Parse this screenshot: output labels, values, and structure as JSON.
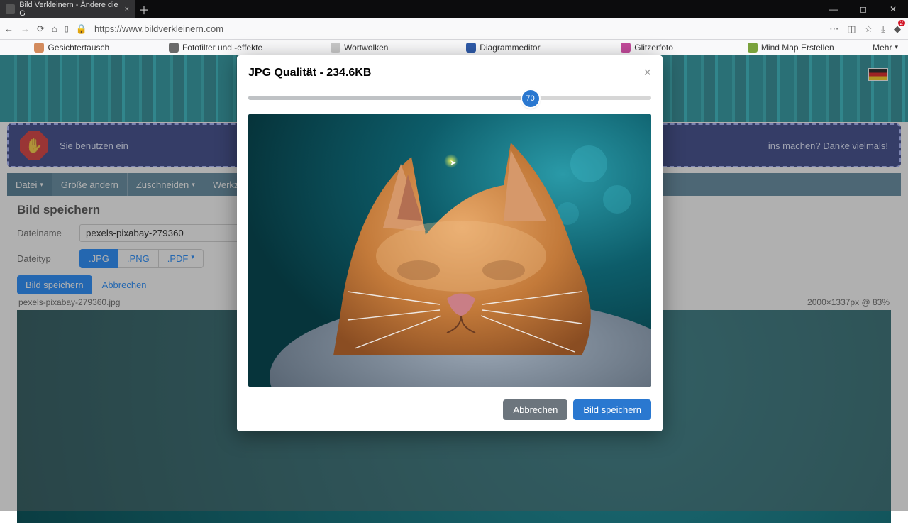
{
  "browser": {
    "tab_title": "Bild Verkleinern - Ändere die G",
    "url": "https://www.bildverkleinern.com",
    "bookmarks": [
      {
        "label": "Gesichtertausch",
        "color": "#d38b5d"
      },
      {
        "label": "Fotofilter und -effekte",
        "color": "#6a6a6a"
      },
      {
        "label": "Wortwolken",
        "color": "#c8c8c8"
      },
      {
        "label": "Diagrammeditor",
        "color": "#2e5aa8"
      },
      {
        "label": "Glitzerfoto",
        "color": "#c24a9a"
      },
      {
        "label": "Mind Map Erstellen",
        "color": "#7aa23c"
      }
    ],
    "more": "Mehr"
  },
  "toolbar": {
    "items": [
      "Datei",
      "Größe ändern",
      "Zuschneiden",
      "Werkzeuge"
    ]
  },
  "form": {
    "heading": "Bild speichern",
    "filename_label": "Dateiname",
    "filename_value": "pexels-pixabay-279360",
    "filetype_label": "Dateityp",
    "types": {
      "jpg": ".JPG",
      "png": ".PNG",
      "pdf": ".PDF"
    },
    "save": "Bild speichern",
    "cancel": "Abbrechen"
  },
  "status": {
    "filename": "pexels-pixabay-279360.jpg",
    "dims": "2000×1337px @  83%"
  },
  "notice": {
    "text_left": "Sie benutzen ein",
    "text_right": "ins machen? Danke vielmals!"
  },
  "modal": {
    "title": "JPG Qualität - 234.6KB",
    "slider_value": "70",
    "cancel": "Abbrechen",
    "save": "Bild speichern"
  }
}
